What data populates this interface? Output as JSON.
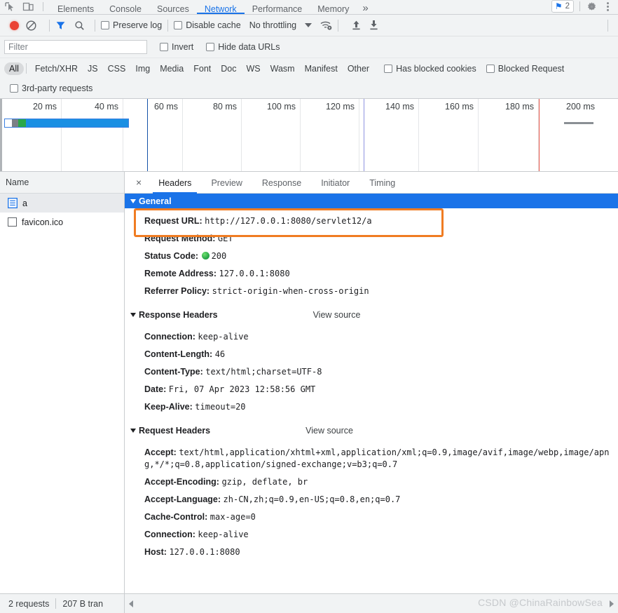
{
  "devtools_tabs": {
    "items": [
      {
        "label": "Elements",
        "active": false
      },
      {
        "label": "Console",
        "active": false
      },
      {
        "label": "Sources",
        "active": false
      },
      {
        "label": "Network",
        "active": true
      },
      {
        "label": "Performance",
        "active": false
      },
      {
        "label": "Memory",
        "active": false
      }
    ],
    "overflow_label": "»",
    "message_count": "2",
    "inspect_icon": "inspect-element-icon",
    "device_icon": "device-toolbar-icon",
    "settings_icon": "gear-icon",
    "menu_icon": "kebab-menu-icon",
    "message_icon": "message-flag-icon"
  },
  "network_toolbar": {
    "record_label": "record-button",
    "clear_label": "clear-button",
    "filter_icon_label": "filter-funnel-icon",
    "search_icon_label": "search-icon",
    "preserve_log": "Preserve log",
    "disable_cache": "Disable cache",
    "throttling": "No throttling",
    "wifi_icon": "network-conditions-icon",
    "import_icon": "import-har-icon",
    "export_icon": "export-har-icon"
  },
  "filter_row": {
    "placeholder": "Filter",
    "value": "",
    "invert": "Invert",
    "hide_data_urls": "Hide data URLs"
  },
  "type_filters": {
    "chips": [
      {
        "label": "All",
        "active": true
      },
      {
        "label": "Fetch/XHR",
        "active": false
      },
      {
        "label": "JS",
        "active": false
      },
      {
        "label": "CSS",
        "active": false
      },
      {
        "label": "Img",
        "active": false
      },
      {
        "label": "Media",
        "active": false
      },
      {
        "label": "Font",
        "active": false
      },
      {
        "label": "Doc",
        "active": false
      },
      {
        "label": "WS",
        "active": false
      },
      {
        "label": "Wasm",
        "active": false
      },
      {
        "label": "Manifest",
        "active": false
      },
      {
        "label": "Other",
        "active": false
      }
    ],
    "has_blocked_cookies": "Has blocked cookies",
    "blocked_requests": "Blocked Request",
    "third_party": "3rd-party requests"
  },
  "overview": {
    "ticks": [
      "20 ms",
      "40 ms",
      "60 ms",
      "80 ms",
      "100 ms",
      "120 ms",
      "140 ms",
      "160 ms",
      "180 ms",
      "200 ms"
    ],
    "bar_label": "request-timing-bar"
  },
  "requests_pane": {
    "column_header": "Name",
    "rows": [
      {
        "name": "a",
        "icon": "document-icon",
        "selected": true
      },
      {
        "name": "favicon.ico",
        "icon": "generic-file-icon",
        "selected": false
      }
    ]
  },
  "detail_tabs": {
    "close_label": "×",
    "items": [
      {
        "label": "Headers",
        "active": true
      },
      {
        "label": "Preview",
        "active": false
      },
      {
        "label": "Response",
        "active": false
      },
      {
        "label": "Initiator",
        "active": false
      },
      {
        "label": "Timing",
        "active": false
      }
    ]
  },
  "sections": {
    "general": {
      "title": "General",
      "rows": [
        {
          "key": "Request URL:",
          "value": "http://127.0.0.1:8080/servlet12/a",
          "highlighted": true
        },
        {
          "key": "Request Method:",
          "value": "GET"
        },
        {
          "key": "Status Code:",
          "value": "200",
          "status_dot": true
        },
        {
          "key": "Remote Address:",
          "value": "127.0.0.1:8080"
        },
        {
          "key": "Referrer Policy:",
          "value": "strict-origin-when-cross-origin"
        }
      ]
    },
    "response_headers": {
      "title": "Response Headers",
      "view_source": "View source",
      "rows": [
        {
          "key": "Connection:",
          "value": "keep-alive"
        },
        {
          "key": "Content-Length:",
          "value": "46"
        },
        {
          "key": "Content-Type:",
          "value": "text/html;charset=UTF-8"
        },
        {
          "key": "Date:",
          "value": "Fri, 07 Apr 2023 12:58:56 GMT"
        },
        {
          "key": "Keep-Alive:",
          "value": "timeout=20"
        }
      ]
    },
    "request_headers": {
      "title": "Request Headers",
      "view_source": "View source",
      "rows": [
        {
          "key": "Accept:",
          "value": "text/html,application/xhtml+xml,application/xml;q=0.9,image/avif,image/webp,image/apng,*/*;q=0.8,application/signed-exchange;v=b3;q=0.7"
        },
        {
          "key": "Accept-Encoding:",
          "value": "gzip, deflate, br"
        },
        {
          "key": "Accept-Language:",
          "value": "zh-CN,zh;q=0.9,en-US;q=0.8,en;q=0.7"
        },
        {
          "key": "Cache-Control:",
          "value": "max-age=0"
        },
        {
          "key": "Connection:",
          "value": "keep-alive"
        },
        {
          "key": "Host:",
          "value": "127.0.0.1:8080"
        }
      ]
    }
  },
  "status_bar": {
    "requests": "2 requests",
    "transferred": "207 B tran"
  },
  "watermark": "CSDN @ChinaRainbowSea",
  "colors": {
    "accent": "#1a73e8",
    "annotation": "#f07c22",
    "status_ok": "#2aa84a",
    "record": "#ea4335",
    "toolbar_bg": "#f1f3f4"
  }
}
